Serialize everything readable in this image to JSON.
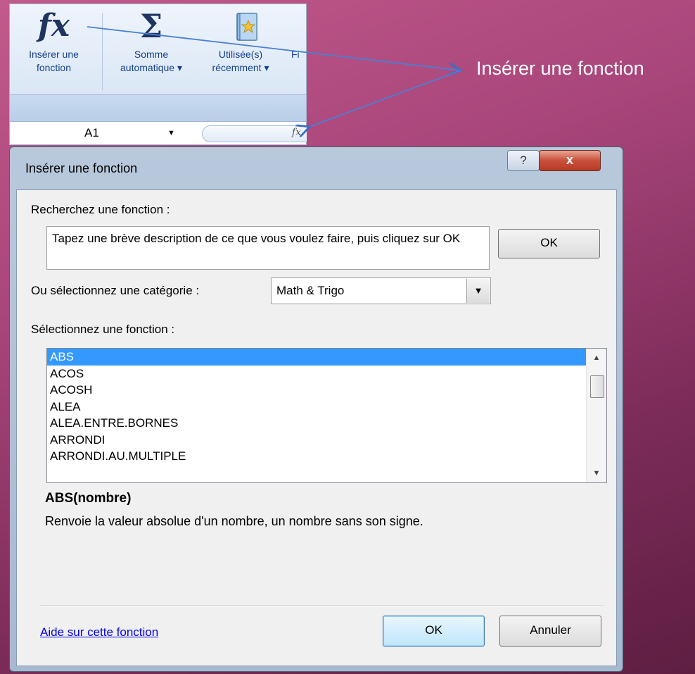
{
  "callout": {
    "text": "Insérer une fonction"
  },
  "ribbon": {
    "insert_function": {
      "line1": "Insérer une",
      "line2": "fonction",
      "icon": "fx-icon"
    },
    "autosum": {
      "line1": "Somme",
      "line2": "automatique ▾",
      "icon": "sigma-icon"
    },
    "recently_used": {
      "line1": "Utilisée(s)",
      "line2": "récemment ▾",
      "icon": "book-icon"
    },
    "truncated": {
      "line1": "Fi"
    }
  },
  "formula_bar": {
    "name_box": "A1",
    "fx_symbol": "fx"
  },
  "dialog": {
    "title": "Insérer une fonction",
    "help_button": "?",
    "close_button": "x",
    "search_label": "Recherchez une fonction :",
    "search_text": "Tapez une brève description de ce que vous voulez faire, puis cliquez sur OK",
    "search_ok": "OK",
    "category_label": "Ou sélectionnez une catégorie :",
    "category_value": "Math & Trigo",
    "select_label": "Sélectionnez une fonction :",
    "functions": [
      "ABS",
      "ACOS",
      "ACOSH",
      "ALEA",
      "ALEA.ENTRE.BORNES",
      "ARRONDI",
      "ARRONDI.AU.MULTIPLE"
    ],
    "selected_index": 0,
    "signature": "ABS(nombre)",
    "description": "Renvoie la valeur absolue d'un nombre, un nombre sans son signe.",
    "help_link": "Aide sur cette fonction",
    "ok": "OK",
    "cancel": "Annuler"
  },
  "colors": {
    "selection": "#3399ff",
    "link": "#0000ff",
    "close": "#c9503a"
  }
}
